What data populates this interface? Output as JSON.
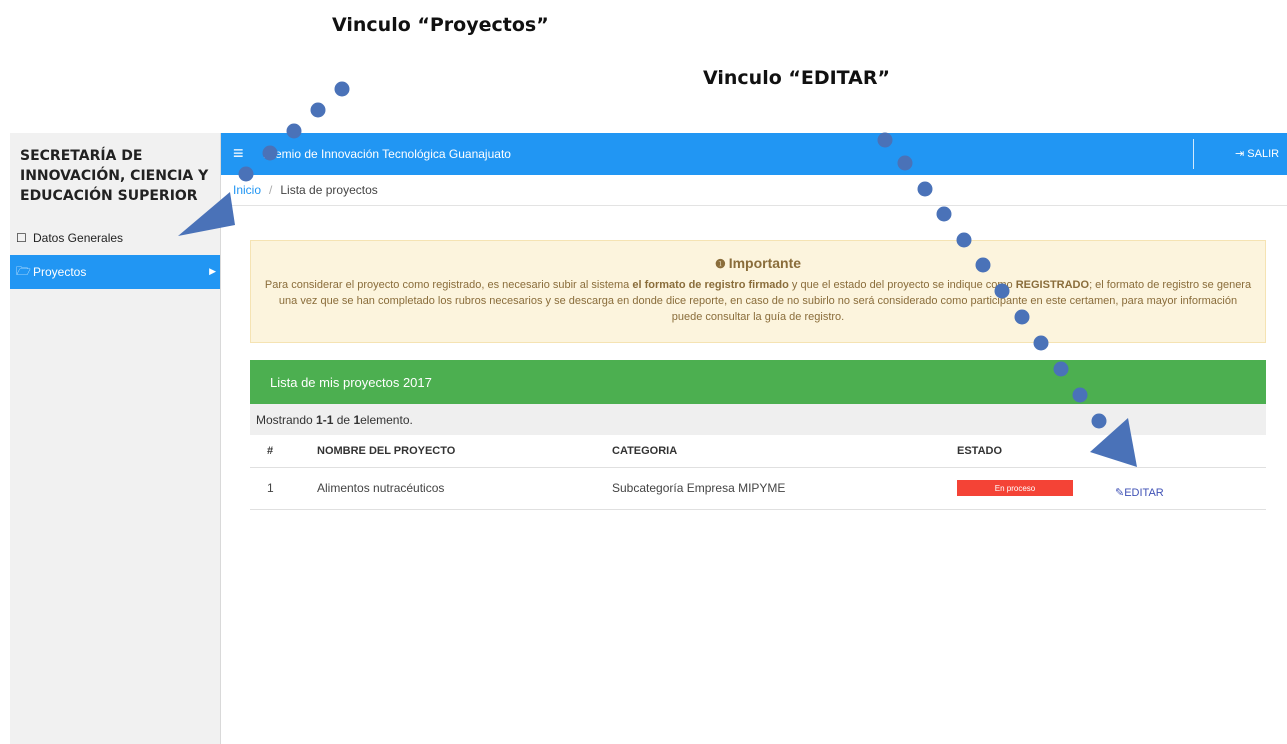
{
  "annotations": {
    "proyectos_caption": "Vinculo “Proyectos”",
    "editar_caption": "Vinculo “EDITAR”"
  },
  "sidebar": {
    "title": "SECRETARÍA DE INNOVACIÓN, CIENCIA Y EDUCACIÓN SUPERIOR",
    "items": [
      {
        "label": "Datos Generales",
        "icon": "file-icon"
      },
      {
        "label": "Proyectos",
        "icon": "folder-open-icon",
        "active": true
      }
    ]
  },
  "topbar": {
    "title": "Premio de Innovación Tecnológica Guanajuato",
    "logout_label": "SALIR",
    "accent_color": "#2196f3"
  },
  "breadcrumb": {
    "home": "Inicio",
    "current": "Lista de proyectos"
  },
  "alert": {
    "title": "Importante",
    "text_1": "Para considerar el proyecto como registrado, es necesario subir al sistema ",
    "bold_1": "el formato de registro firmado",
    "text_2": " y que el estado del proyecto se indique como ",
    "bold_2": "REGISTRADO",
    "text_3": "; el formato de registro se genera una vez que se han completado los rubros necesarios y se descarga en donde dice reporte, en caso de no subirlo no será considerado como participante en este certamen, para mayor información puede consultar la guía de registro."
  },
  "panel": {
    "title": "Lista de mis proyectos 2017",
    "header_color": "#4caf50",
    "summary_prefix": "Mostrando ",
    "summary_range": "1-1",
    "summary_mid": " de ",
    "summary_total": "1",
    "summary_suffix": " elemento."
  },
  "table": {
    "columns": [
      "#",
      "NOMBRE DEL PROYECTO",
      "CATEGORIA",
      "ESTADO"
    ],
    "rows": [
      {
        "num": "1",
        "name": "Alimentos nutracéuticos",
        "category": "Subcategoría Empresa MIPYME",
        "status": "En proceso",
        "action": "EDITAR"
      }
    ]
  }
}
